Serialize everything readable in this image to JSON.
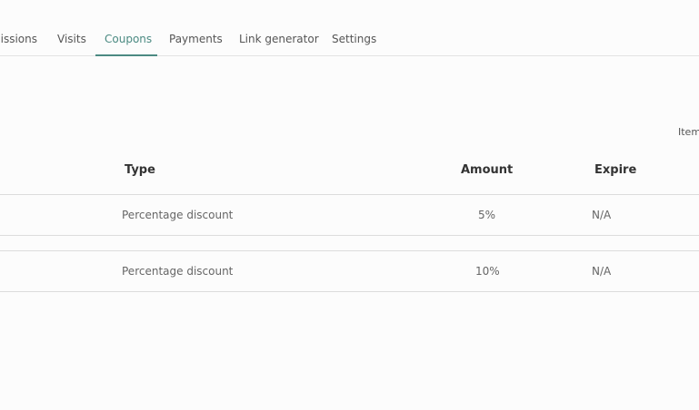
{
  "tabs": [
    {
      "label": "nissions"
    },
    {
      "label": "Visits"
    },
    {
      "label": "Coupons",
      "active": true
    },
    {
      "label": "Payments"
    },
    {
      "label": "Link generator"
    },
    {
      "label": "Settings"
    }
  ],
  "items_label": "Item",
  "table": {
    "headers": {
      "type": "Type",
      "amount": "Amount",
      "expire": "Expire"
    },
    "rows": [
      {
        "type": "Percentage discount",
        "amount": "5%",
        "expire": "N/A"
      },
      {
        "type": "Percentage discount",
        "amount": "10%",
        "expire": "N/A"
      }
    ]
  },
  "colors": {
    "accent": "#4b8a82"
  }
}
